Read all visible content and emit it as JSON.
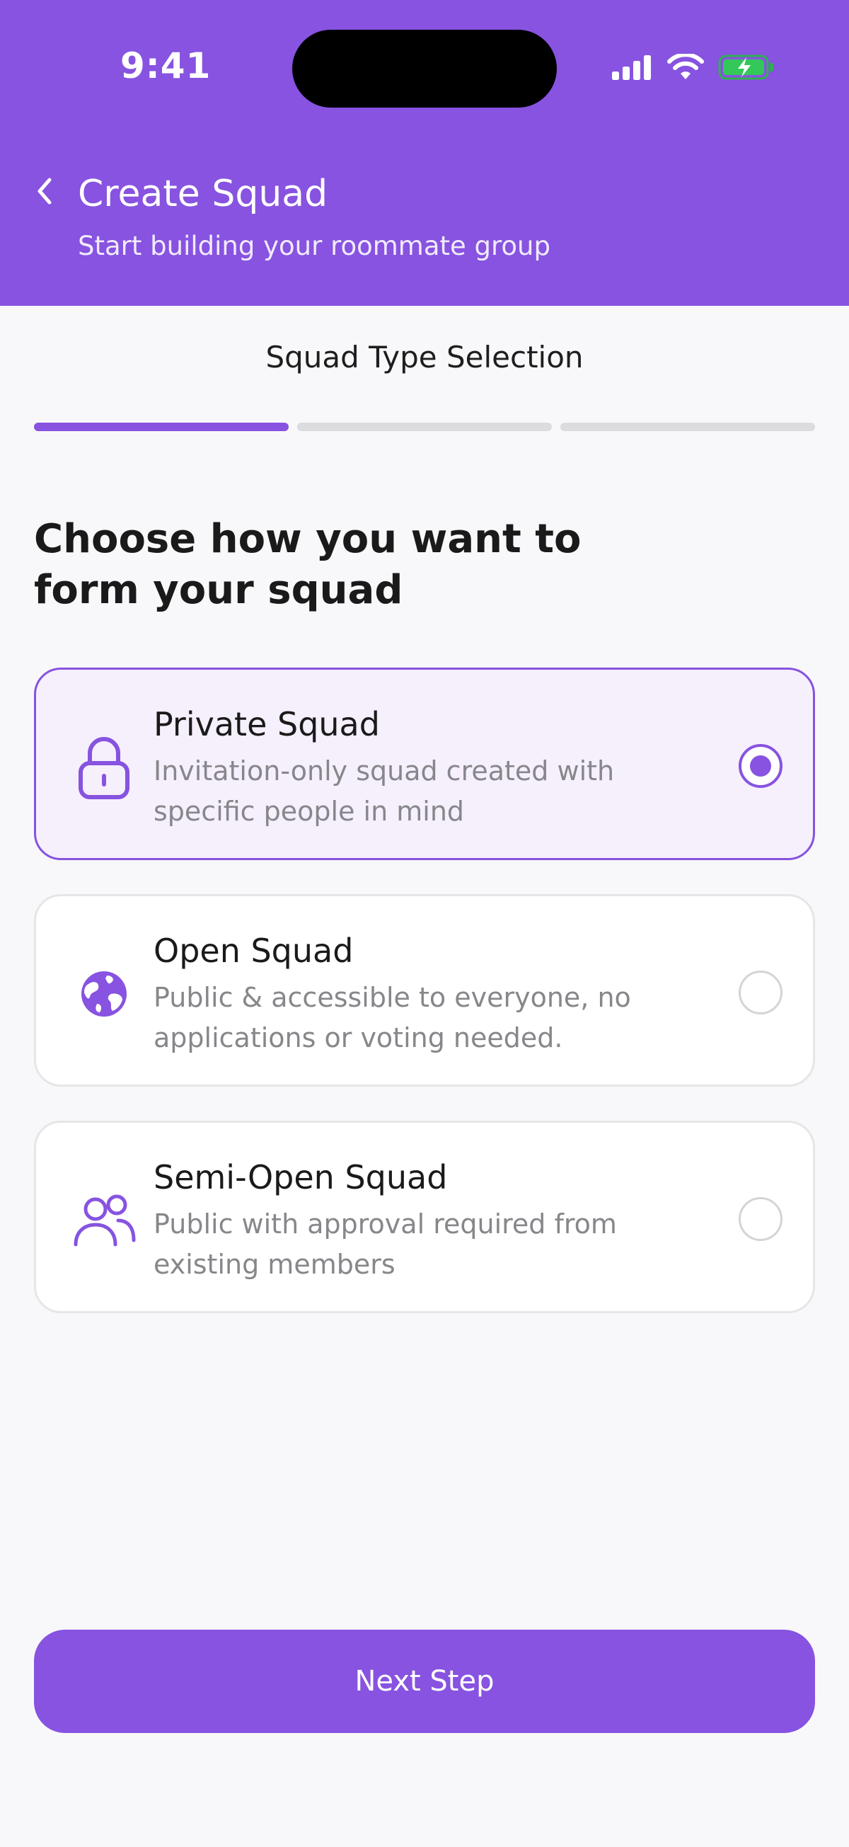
{
  "status_bar": {
    "time": "9:41",
    "icons": [
      "signal-icon",
      "wifi-icon",
      "battery-charging-icon"
    ]
  },
  "header": {
    "title": "Create Squad",
    "subtitle": "Start building your roommate group",
    "back_icon": "chevron-left-icon"
  },
  "steps": {
    "label": "Squad Type Selection",
    "total": 3,
    "current": 1
  },
  "heading": "Choose how you want to form your squad",
  "options": [
    {
      "icon": "lock-icon",
      "title": "Private Squad",
      "description": "Invitation-only squad created with specific people in mind",
      "selected": true
    },
    {
      "icon": "globe-icon",
      "title": "Open Squad",
      "description": "Public & accessible to everyone, no applications or voting needed.",
      "selected": false
    },
    {
      "icon": "users-icon",
      "title": "Semi-Open Squad",
      "description": "Public with approval required from existing members",
      "selected": false
    }
  ],
  "next_button": {
    "label": "Next Step"
  },
  "colors": {
    "brand": "#8753E0",
    "selected_card_bg": "#F6EFFC",
    "battery": "#34C759"
  }
}
